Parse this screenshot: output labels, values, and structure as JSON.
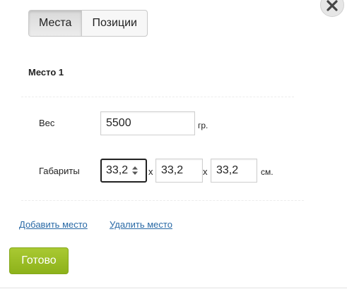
{
  "tabs": [
    {
      "label": "Места",
      "active": true
    },
    {
      "label": "Позиции",
      "active": false
    }
  ],
  "place": {
    "title": "Место 1",
    "weight_label": "Вес",
    "weight_value": "5500",
    "weight_unit": "гр.",
    "dims_label": "Габариты",
    "dim1": "33,2",
    "dim2": "33,2",
    "dim3": "33,2",
    "separator": "x",
    "dims_unit": "см."
  },
  "links": {
    "add_place": "Добавить место",
    "remove_place": "Удалить место"
  },
  "done_label": "Готово",
  "colors": {
    "accent": "#8db21a",
    "link": "#2a6aa6"
  },
  "icons": {
    "close": "close-icon",
    "spinner": "spinner-arrows-icon"
  }
}
